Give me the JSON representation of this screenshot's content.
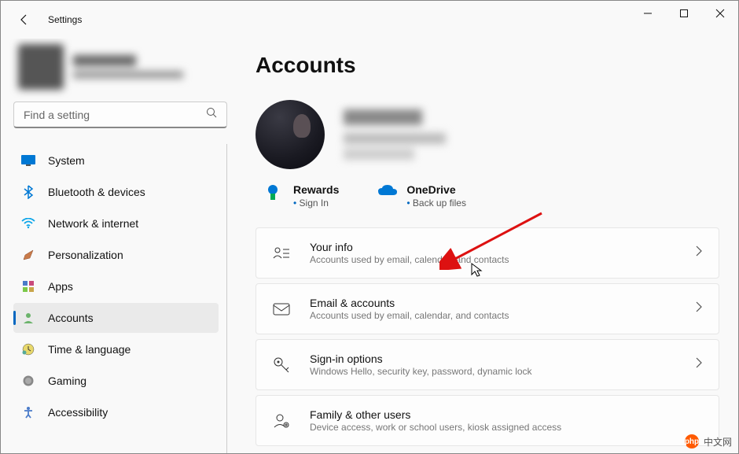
{
  "app_title": "Settings",
  "search": {
    "placeholder": "Find a setting"
  },
  "nav": [
    {
      "key": "system",
      "label": "System"
    },
    {
      "key": "bluetooth",
      "label": "Bluetooth & devices"
    },
    {
      "key": "network",
      "label": "Network & internet"
    },
    {
      "key": "personalization",
      "label": "Personalization"
    },
    {
      "key": "apps",
      "label": "Apps"
    },
    {
      "key": "accounts",
      "label": "Accounts"
    },
    {
      "key": "time",
      "label": "Time & language"
    },
    {
      "key": "gaming",
      "label": "Gaming"
    },
    {
      "key": "accessibility",
      "label": "Accessibility"
    }
  ],
  "nav_active": "accounts",
  "page": {
    "title": "Accounts",
    "tiles": [
      {
        "key": "rewards",
        "title": "Rewards",
        "link": "Sign In"
      },
      {
        "key": "onedrive",
        "title": "OneDrive",
        "link": "Back up files"
      }
    ],
    "cards": [
      {
        "key": "your-info",
        "title": "Your info",
        "desc": "Accounts used by email, calendar, and contacts"
      },
      {
        "key": "email-accounts",
        "title": "Email & accounts",
        "desc": "Accounts used by email, calendar, and contacts"
      },
      {
        "key": "signin-options",
        "title": "Sign-in options",
        "desc": "Windows Hello, security key, password, dynamic lock"
      },
      {
        "key": "family-users",
        "title": "Family & other users",
        "desc": "Device access, work or school users, kiosk assigned access"
      }
    ]
  },
  "watermark": "中文网"
}
